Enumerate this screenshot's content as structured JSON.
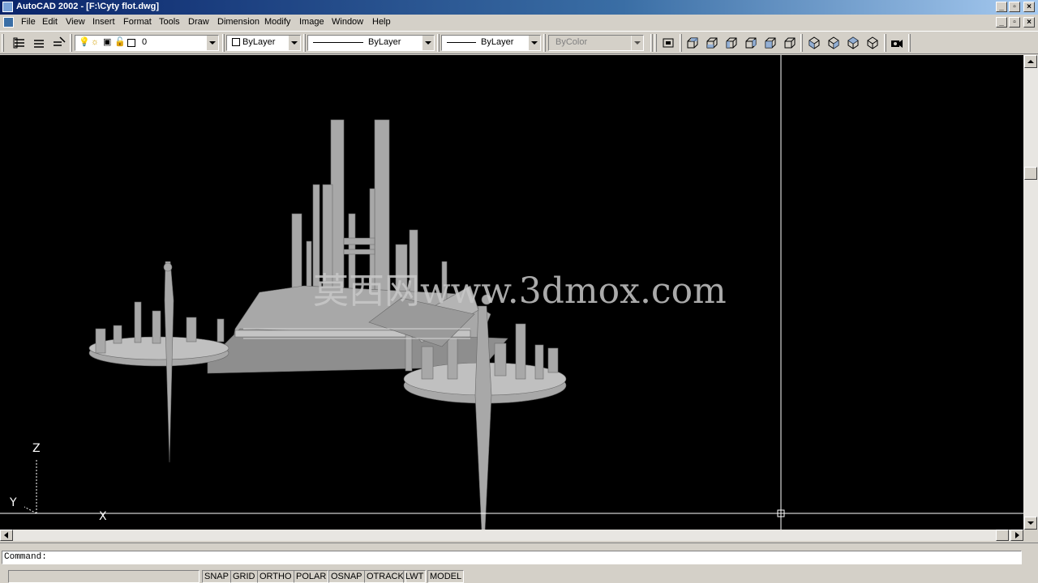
{
  "window": {
    "title": "AutoCAD 2002 - [F:\\Cyty flot.dwg]"
  },
  "menu": {
    "items": [
      "File",
      "Edit",
      "View",
      "Insert",
      "Format",
      "Tools",
      "Draw",
      "Dimension",
      "Modify",
      "Image",
      "Window",
      "Help"
    ]
  },
  "toolbar": {
    "layer_value": "0",
    "color_value": "ByLayer",
    "linetype_value": "ByLayer",
    "lineweight_value": "ByLayer",
    "plotstyle_value": "ByColor"
  },
  "canvas": {
    "watermark": "莫西网www.3dmox.com",
    "ucs_labels": {
      "z": "Z",
      "y": "Y",
      "x": "X"
    },
    "background": "#000000",
    "model_color": "#a8a8a8"
  },
  "command": {
    "prompt": "Command:"
  },
  "status": {
    "buttons": [
      "SNAP",
      "GRID",
      "ORTHO",
      "POLAR",
      "OSNAP",
      "OTRACK",
      "LWT",
      "MODEL"
    ]
  },
  "colors": {
    "titlebar_start": "#0a246a",
    "titlebar_end": "#a6caf0",
    "chrome": "#d4d0c8"
  }
}
